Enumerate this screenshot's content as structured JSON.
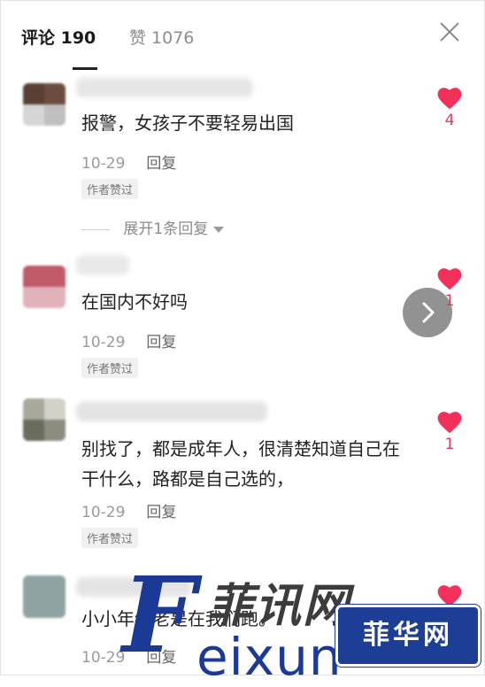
{
  "header": {
    "comments_tab": "评论 190",
    "likes_tab": "赞 1076"
  },
  "colors": {
    "accent_like": "#f2305a",
    "watermark_blue": "#1b3a96"
  },
  "comments": [
    {
      "text": "报警，女孩子不要轻易出国",
      "date": "10-29",
      "reply_label": "回复",
      "badge": "作者赞过",
      "likes": "4",
      "expand_label": "展开1条回复"
    },
    {
      "text": "在国内不好吗",
      "date": "10-29",
      "reply_label": "回复",
      "badge": "作者赞过",
      "likes": "1"
    },
    {
      "text": "别找了，都是成年人，很清楚知道自己在干什么，路都是自己选的，",
      "date": "10-29",
      "reply_label": "回复",
      "badge": "作者赞过",
      "likes": "1"
    },
    {
      "text": "小小年纪老是在我们跑。",
      "date": "10-29",
      "reply_label": "回复"
    }
  ],
  "watermark": {
    "letter": "F",
    "chinese": "菲讯网",
    "latin": "eixun",
    "box": "菲华网"
  },
  "icons": [
    "close-icon",
    "heart-icon",
    "chevron-right-icon",
    "caret-down-icon"
  ]
}
